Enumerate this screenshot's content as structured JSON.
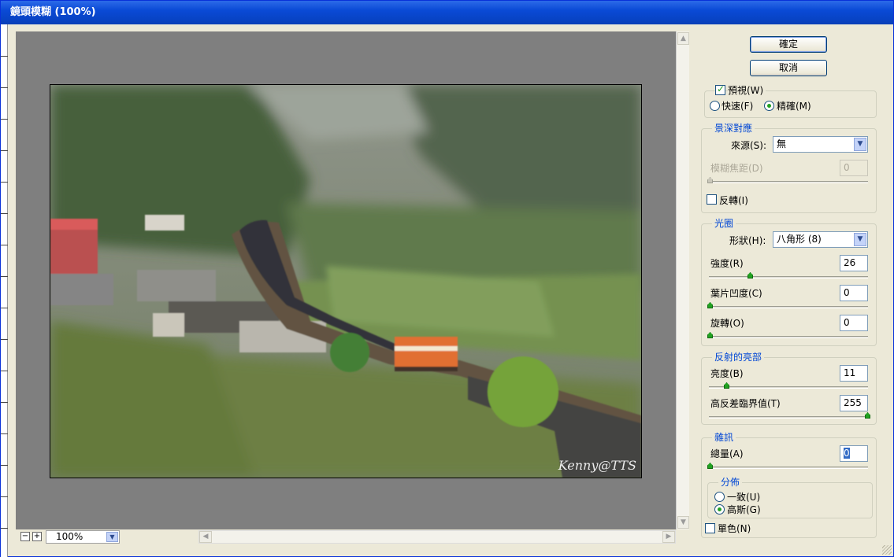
{
  "window": {
    "title": "鏡頭模糊 (100%)"
  },
  "preview": {
    "zoom": "100%",
    "zoom_out": "−",
    "zoom_in": "+",
    "watermark": "Kenny@TTS"
  },
  "buttons": {
    "ok": "確定",
    "cancel": "取消"
  },
  "preview_opts": {
    "preview_label": "預視(W)",
    "preview_checked": true,
    "fast_label": "快速(F)",
    "accurate_label": "精確(M)",
    "selected": "accurate"
  },
  "depth_map": {
    "title": "景深對應",
    "source_label": "來源(S):",
    "source_value": "無",
    "blur_focal_label": "模糊焦距(D)",
    "blur_focal_value": "0",
    "invert_label": "反轉(I)",
    "invert_checked": false
  },
  "iris": {
    "title": "光圈",
    "shape_label": "形狀(H):",
    "shape_value": "八角形 (8)",
    "radius_label": "強度(R)",
    "radius_value": "26",
    "curvature_label": "葉片凹度(C)",
    "curvature_value": "0",
    "rotation_label": "旋轉(O)",
    "rotation_value": "0"
  },
  "specular": {
    "title": "反射的亮部",
    "brightness_label": "亮度(B)",
    "brightness_value": "11",
    "threshold_label": "高反差臨界值(T)",
    "threshold_value": "255"
  },
  "noise": {
    "title": "雜訊",
    "amount_label": "總量(A)",
    "amount_value": "0",
    "dist_title": "分佈",
    "uniform_label": "一致(U)",
    "gaussian_label": "高斯(G)",
    "dist_selected": "gaussian",
    "mono_label": "單色(N)",
    "mono_checked": false
  },
  "colors": {
    "accent": "#0046d5",
    "title_bar": "#0a4ad6",
    "check": "#21a121"
  }
}
